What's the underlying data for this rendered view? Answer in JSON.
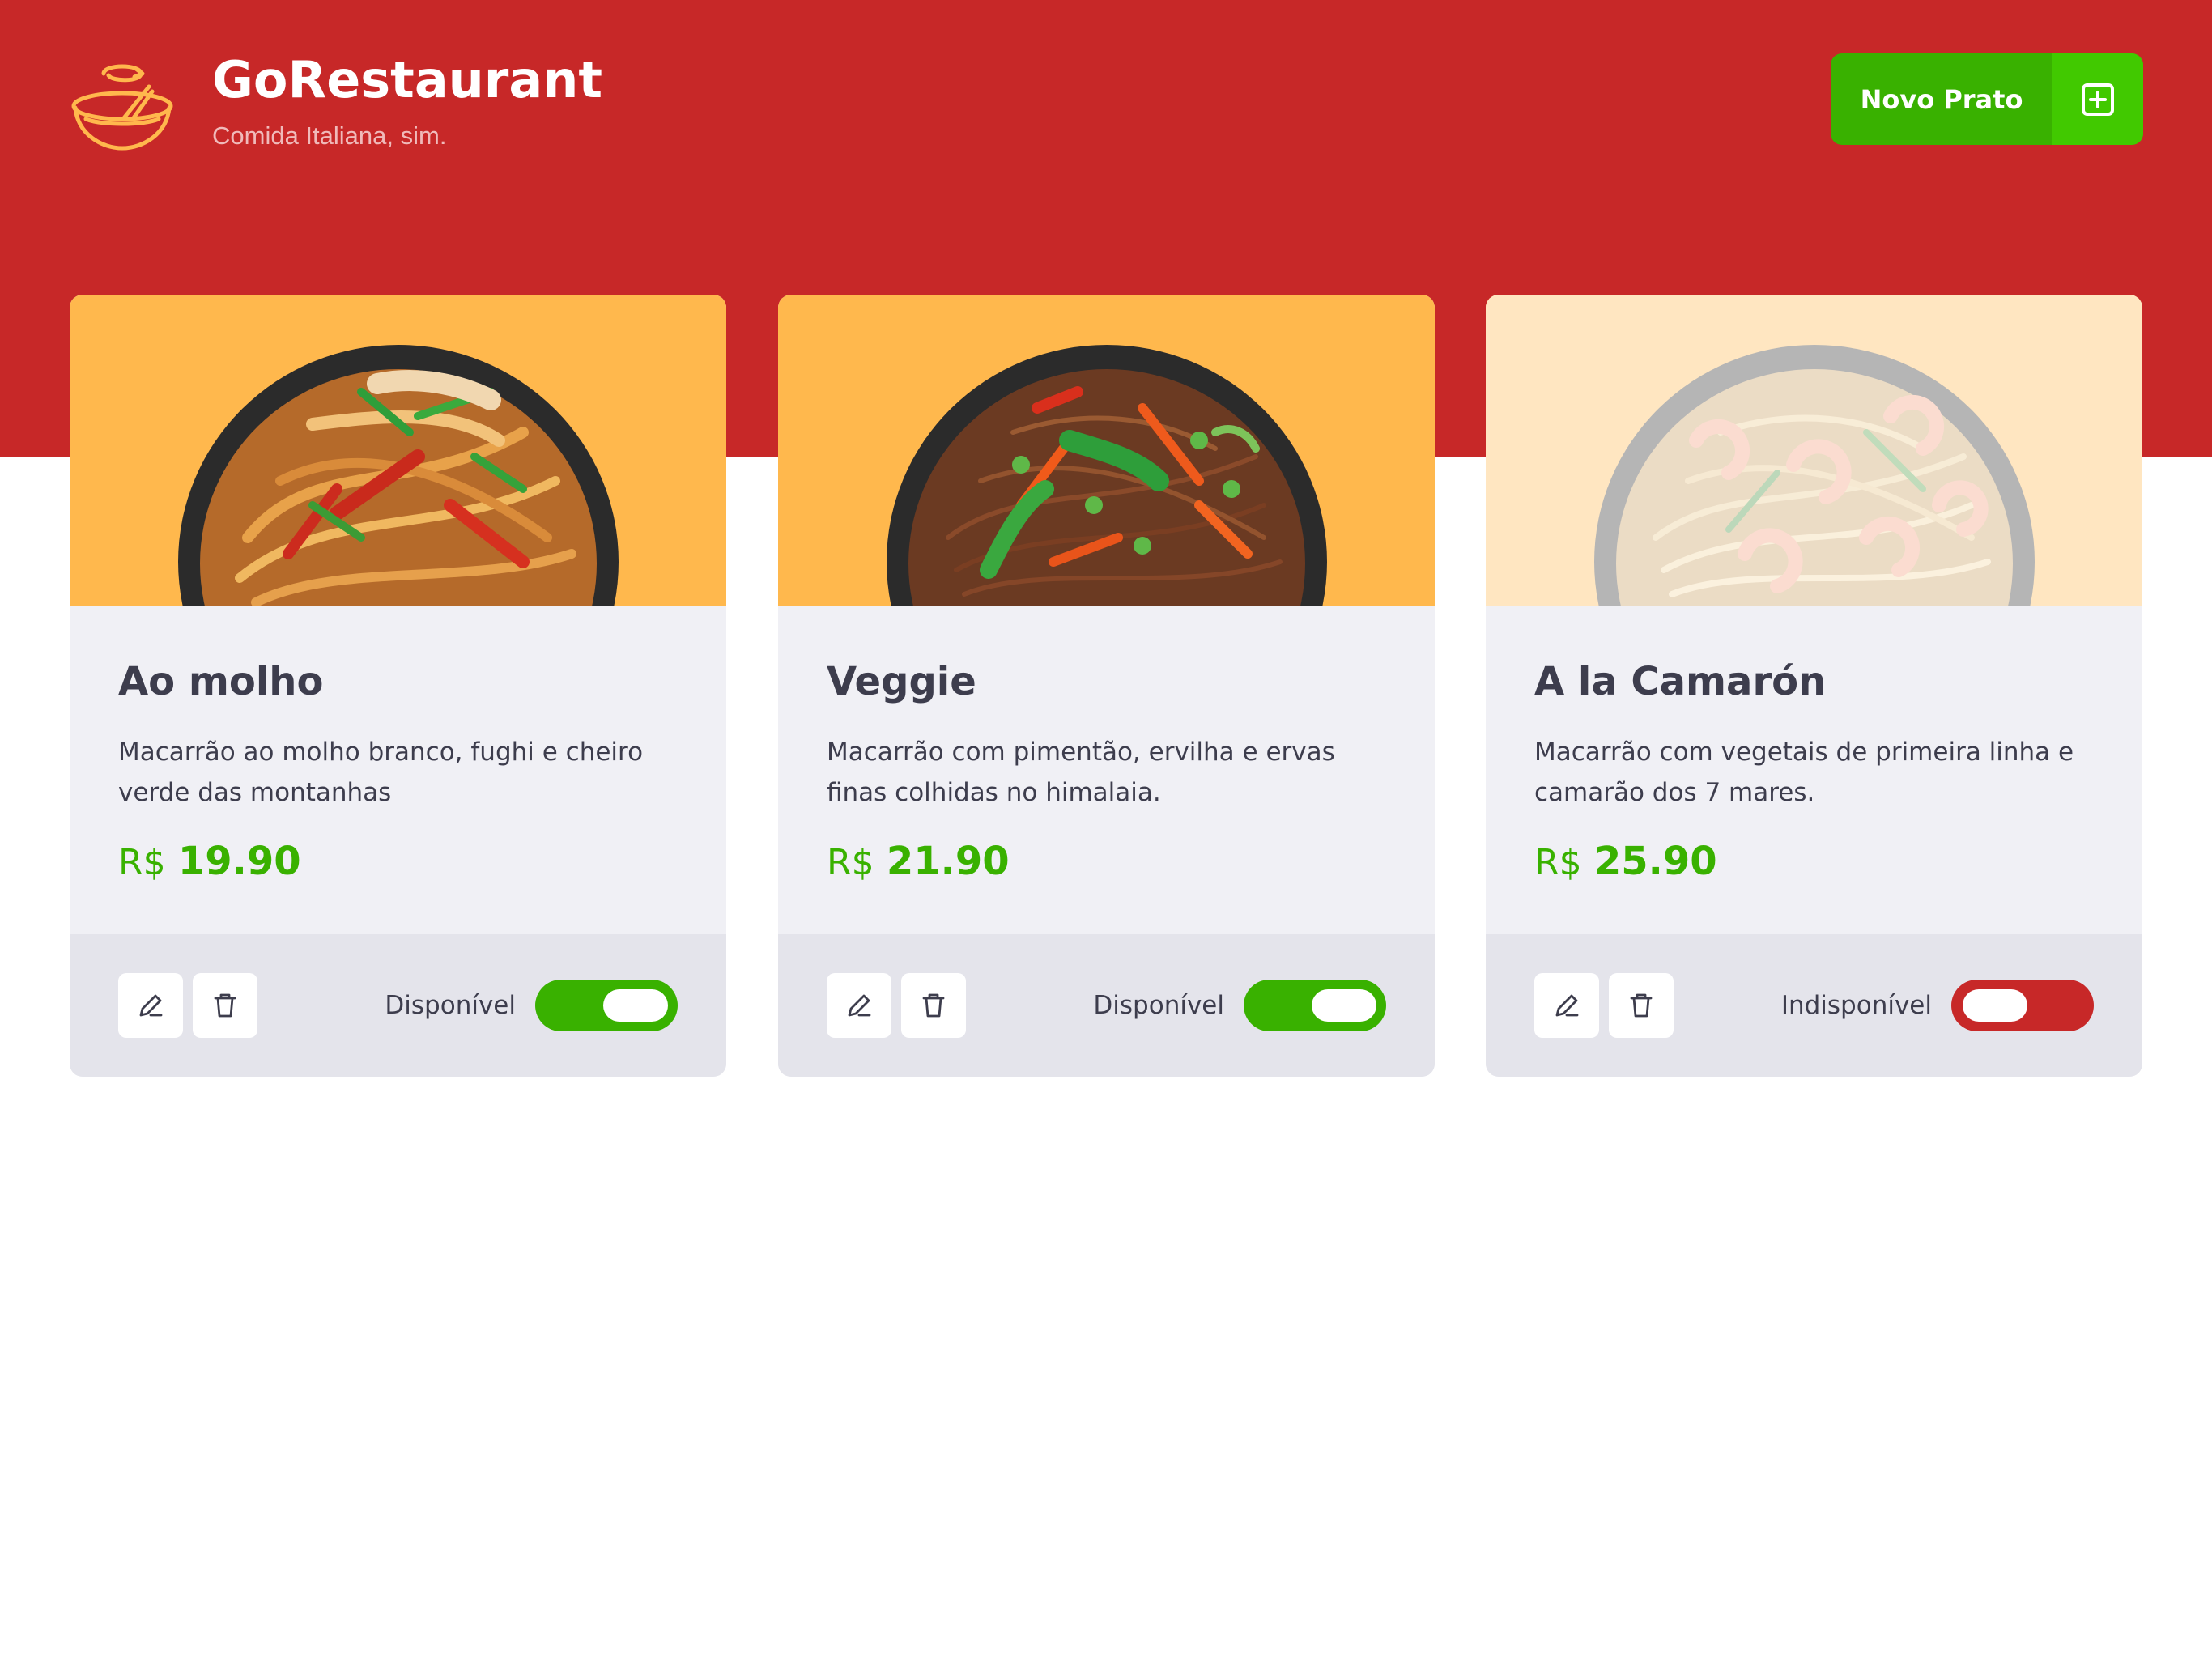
{
  "header": {
    "title": "GoRestaurant",
    "subtitle": "Comida Italiana, sim.",
    "new_dish_label": "Novo Prato",
    "logo_icon": "bowl-icon",
    "add_icon": "plus-square-icon"
  },
  "colors": {
    "header_bg": "#c72828",
    "accent_green": "#39b100",
    "accent_green_light": "#41c900",
    "unavailable_red": "#c72828",
    "card_bg": "#f0f0f5",
    "footer_bg": "#e4e4eb",
    "image_bg": "#ffb84d",
    "text": "#3d3d4d"
  },
  "dishes": [
    {
      "name": "Ao molho",
      "description": "Macarrão ao molho branco, fughi e cheiro verde das montanhas",
      "price_currency": "R$",
      "price_value": "19.90",
      "availability_label": "Disponível",
      "available": true,
      "edit_icon": "pencil-icon",
      "delete_icon": "trash-icon"
    },
    {
      "name": "Veggie",
      "description": "Macarrão com pimentão, ervilha e ervas finas colhidas no himalaia.",
      "price_currency": "R$",
      "price_value": "21.90",
      "availability_label": "Disponível",
      "available": true,
      "edit_icon": "pencil-icon",
      "delete_icon": "trash-icon"
    },
    {
      "name": "A la Camarón",
      "description": "Macarrão com vegetais de primeira linha e camarão dos 7 mares.",
      "price_currency": "R$",
      "price_value": "25.90",
      "availability_label": "Indisponível",
      "available": false,
      "edit_icon": "pencil-icon",
      "delete_icon": "trash-icon"
    }
  ]
}
